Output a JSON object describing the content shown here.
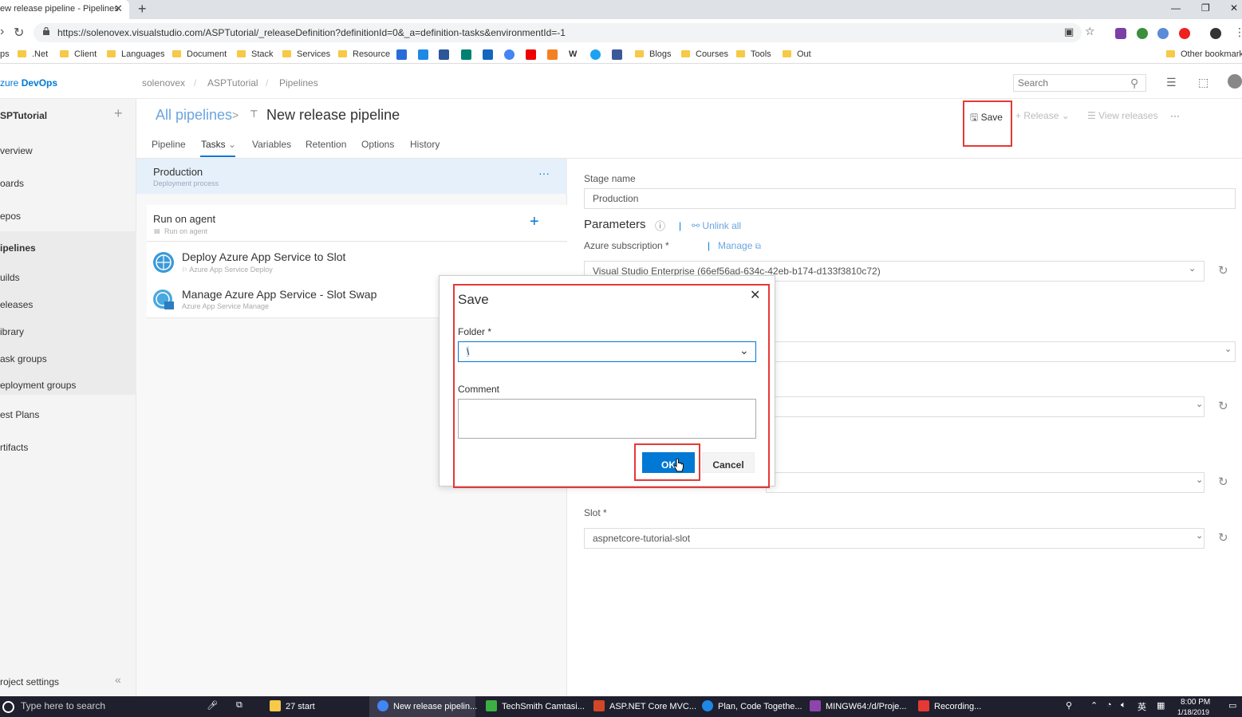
{
  "browser": {
    "tab_title": "New release pipeline - Pipelines",
    "tab_title_visible": "ew release pipeline - Pipelines",
    "close_glyph": "✕",
    "new_tab_glyph": "+",
    "url": "https://solenovex.visualstudio.com/ASPTutorial/_releaseDefinition?definitionId=0&_a=definition-tasks&environmentId=-1",
    "bookmarks": [
      ".Net",
      "Client",
      "Languages",
      "Document",
      "Stack",
      "Services",
      "Resource",
      "Blogs",
      "Courses",
      "Tools",
      "Out"
    ],
    "bookmarks_left": "ps",
    "other_bookmarks": "Other bookmarks",
    "icons": [
      "back-icon",
      "reload-icon",
      "lock-icon",
      "star-icon",
      "cast-icon"
    ]
  },
  "header": {
    "brand_prefix": "zure ",
    "brand_bold": "DevOps",
    "breadcrumb": [
      "solenovex",
      "ASPTutorial",
      "Pipelines"
    ],
    "separator": "/",
    "search_placeholder": "Search",
    "search_glyph": "⚲",
    "list_glyph": "☰",
    "bag_glyph": "⬚"
  },
  "sidebar": {
    "project": "SPTutorial",
    "add_glyph": "+",
    "collapse_glyph": "«",
    "items": [
      "verview",
      "oards",
      "epos",
      "ipelines",
      "uilds",
      "eleases",
      "ibrary",
      "ask groups",
      "eployment groups",
      "est Plans",
      "rtifacts"
    ],
    "settings": "roject settings"
  },
  "page": {
    "crumb_root": "All pipelines",
    "crumb_sep": ">",
    "pipeline_glyph": "⊤",
    "title": "New release pipeline",
    "tabs": [
      "Pipeline",
      "Tasks",
      "Variables",
      "Retention",
      "Options",
      "History"
    ],
    "tasks_chevron": "⌄",
    "commands": {
      "save": "Save",
      "save_glyph": "🖫",
      "release": "Release",
      "release_glyph": "+",
      "release_chevron": "⌄",
      "view_releases": "View releases",
      "view_glyph": "☰",
      "more": "···"
    }
  },
  "tasks": {
    "stage": "Production",
    "stage_sub": "Deployment process",
    "stage_more": "···",
    "agent": "Run on agent",
    "agent_sub": "Run on agent",
    "agent_add": "+",
    "items": [
      {
        "title": "Deploy Azure App Service to Slot",
        "sub": "Azure App Service Deploy"
      },
      {
        "title": "Manage Azure App Service - Slot Swap",
        "sub": "Azure App Service Manage"
      }
    ]
  },
  "config": {
    "stage_name_label": "Stage name",
    "stage_name_value": "Production",
    "parameters": "Parameters",
    "info_glyph": "ⓘ",
    "unlink_all": "Unlink all",
    "unlink_glyph": "⚯",
    "azure_sub_label": "Azure subscription *",
    "manage": "Manage",
    "manage_glyph": "⧉",
    "azure_sub_value": "Visual Studio Enterprise (66ef56ad-634c-42eb-b174-d133f3810c72)",
    "slot_label": "Slot *",
    "slot_value": "aspnetcore-tutorial-slot",
    "chevron_glyph": "⌄",
    "refresh_glyph": "↻"
  },
  "dialog": {
    "title": "Save",
    "close_glyph": "✕",
    "folder_label": "Folder *",
    "folder_value": "\\",
    "folder_chevron": "⌄",
    "comment_label": "Comment",
    "ok": "OK",
    "cancel": "Cancel"
  },
  "taskbar": {
    "search": "Type here to search",
    "items": [
      "27 start",
      "New release pipelin...",
      "TechSmith Camtasi...",
      "ASP.NET Core MVC...",
      "Plan, Code Togethe...",
      "MINGW64:/d/Proje...",
      "Recording..."
    ],
    "ime": "英",
    "time": "8:00 PM",
    "date": "1/18/2019"
  },
  "colors": {
    "accent": "#0078d4",
    "highlight_box": "#e53935"
  }
}
